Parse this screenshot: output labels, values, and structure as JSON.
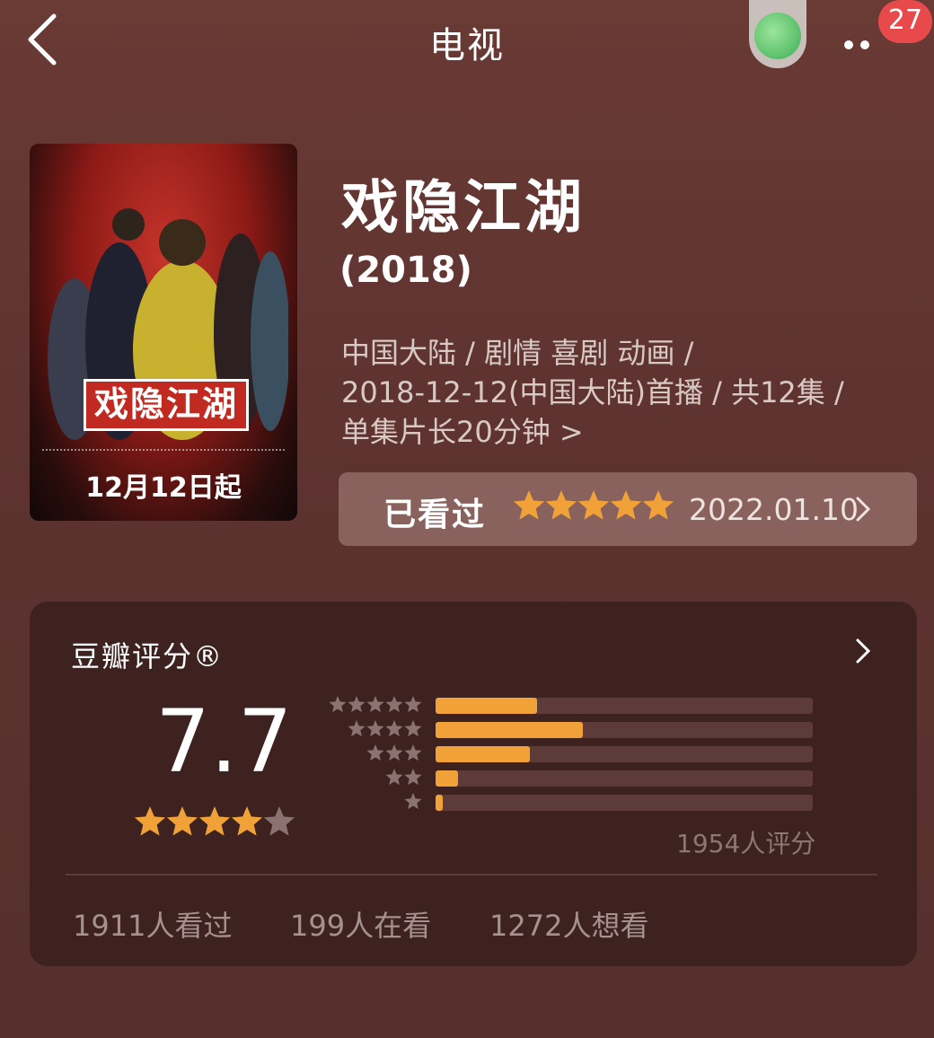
{
  "nav": {
    "title": "电视",
    "badge": "27"
  },
  "poster": {
    "logo_text": "戏隐江湖",
    "date_text": "12月12日起"
  },
  "title": "戏隐江湖",
  "year": "(2018)",
  "meta": {
    "line1": "中国大陆 / 剧情 喜剧 动画 /",
    "line2": "2018-12-12(中国大陆)首播 / 共12集 /",
    "line3": "单集片长20分钟 >"
  },
  "watched": {
    "label": "已看过",
    "rating_stars": 5,
    "date": "2022.01.10"
  },
  "douban": {
    "header": "豆瓣评分®",
    "score": "7.7",
    "score_stars": 4,
    "distribution": [
      {
        "stars": 5,
        "fraction": 0.27
      },
      {
        "stars": 4,
        "fraction": 0.39
      },
      {
        "stars": 3,
        "fraction": 0.25
      },
      {
        "stars": 2,
        "fraction": 0.06
      },
      {
        "stars": 1,
        "fraction": 0.02
      }
    ],
    "rating_count": "1954人评分",
    "watched_count": "1911人看过",
    "watching_count": "199人在看",
    "want_count": "1272人想看"
  },
  "colors": {
    "accent": "#f0a238",
    "badge": "#e84a4c"
  }
}
